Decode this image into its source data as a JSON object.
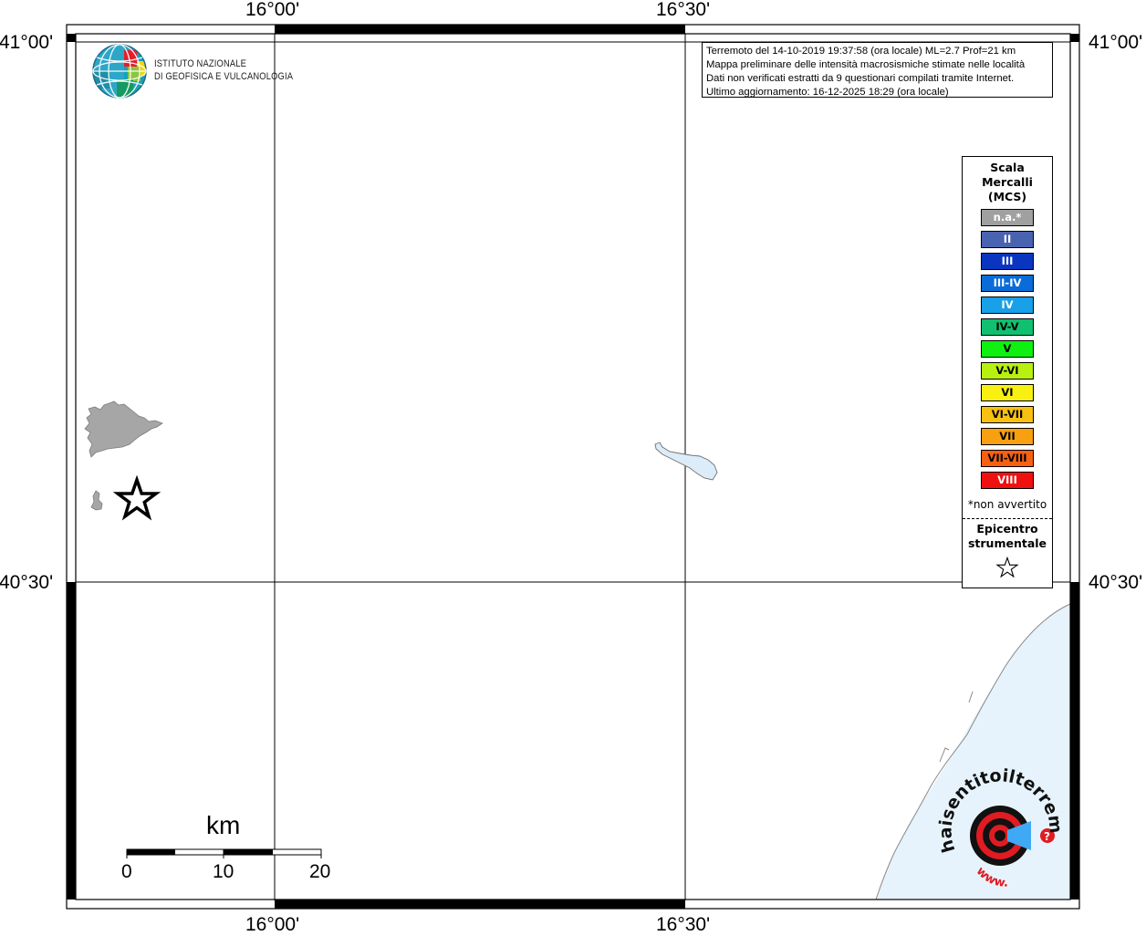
{
  "axis_labels": {
    "top_left": "16°00'",
    "top_right": "16°30'",
    "bottom_left": "16°00'",
    "bottom_right": "16°30'",
    "left_top": "41°00'",
    "left_mid": "40°30'",
    "right_top": "41°00'",
    "right_mid": "40°30'"
  },
  "logo": {
    "line1": "ISTITUTO NAZIONALE",
    "line2": "DI GEOFISICA E VULCANOLOGIA"
  },
  "info": {
    "line1": "Terremoto del 14-10-2019 19:37:58 (ora locale) ML=2.7 Prof=21 km",
    "line2": "Mappa preliminare delle intensità macrosismiche stimate nelle località",
    "line3": "Dati non verificati estratti da 9 questionari compilati tramite Internet.",
    "line4": "Ultimo aggiornamento: 16-12-2025 18:29 (ora locale)"
  },
  "legend": {
    "title1": "Scala",
    "title2": "Mercalli",
    "title3": "(MCS)",
    "items": [
      {
        "label": "n.a.*",
        "color": "#a0a0a0",
        "text_color": "#ffffff"
      },
      {
        "label": "II",
        "color": "#4a63b0",
        "text_color": "#ffffff"
      },
      {
        "label": "III",
        "color": "#0a35c0",
        "text_color": "#ffffff"
      },
      {
        "label": "III-IV",
        "color": "#0a6cd8",
        "text_color": "#ffffff"
      },
      {
        "label": "IV",
        "color": "#18a0e8",
        "text_color": "#ffffff"
      },
      {
        "label": "IV-V",
        "color": "#10c070",
        "text_color": "#000000"
      },
      {
        "label": "V",
        "color": "#10f010",
        "text_color": "#000000"
      },
      {
        "label": "V-VI",
        "color": "#b8f010",
        "text_color": "#000000"
      },
      {
        "label": "VI",
        "color": "#f8f010",
        "text_color": "#000000"
      },
      {
        "label": "VI-VII",
        "color": "#f8c010",
        "text_color": "#000000"
      },
      {
        "label": "VII",
        "color": "#f8a010",
        "text_color": "#000000"
      },
      {
        "label": "VII-VIII",
        "color": "#f86010",
        "text_color": "#000000"
      },
      {
        "label": "VIII",
        "color": "#f01010",
        "text_color": "#ffffff"
      }
    ],
    "note": "*non avvertito",
    "epi1": "Epicentro",
    "epi2": "strumentale"
  },
  "scalebar": {
    "unit": "km",
    "labels": [
      "0",
      "10",
      "20"
    ]
  },
  "watermark": {
    "text": "haisentitoilterremoto.it",
    "www": "www."
  },
  "colors": {
    "sea": "#e6f3fc",
    "urban": "#a6a6a6",
    "lake": "#dcecf8"
  }
}
